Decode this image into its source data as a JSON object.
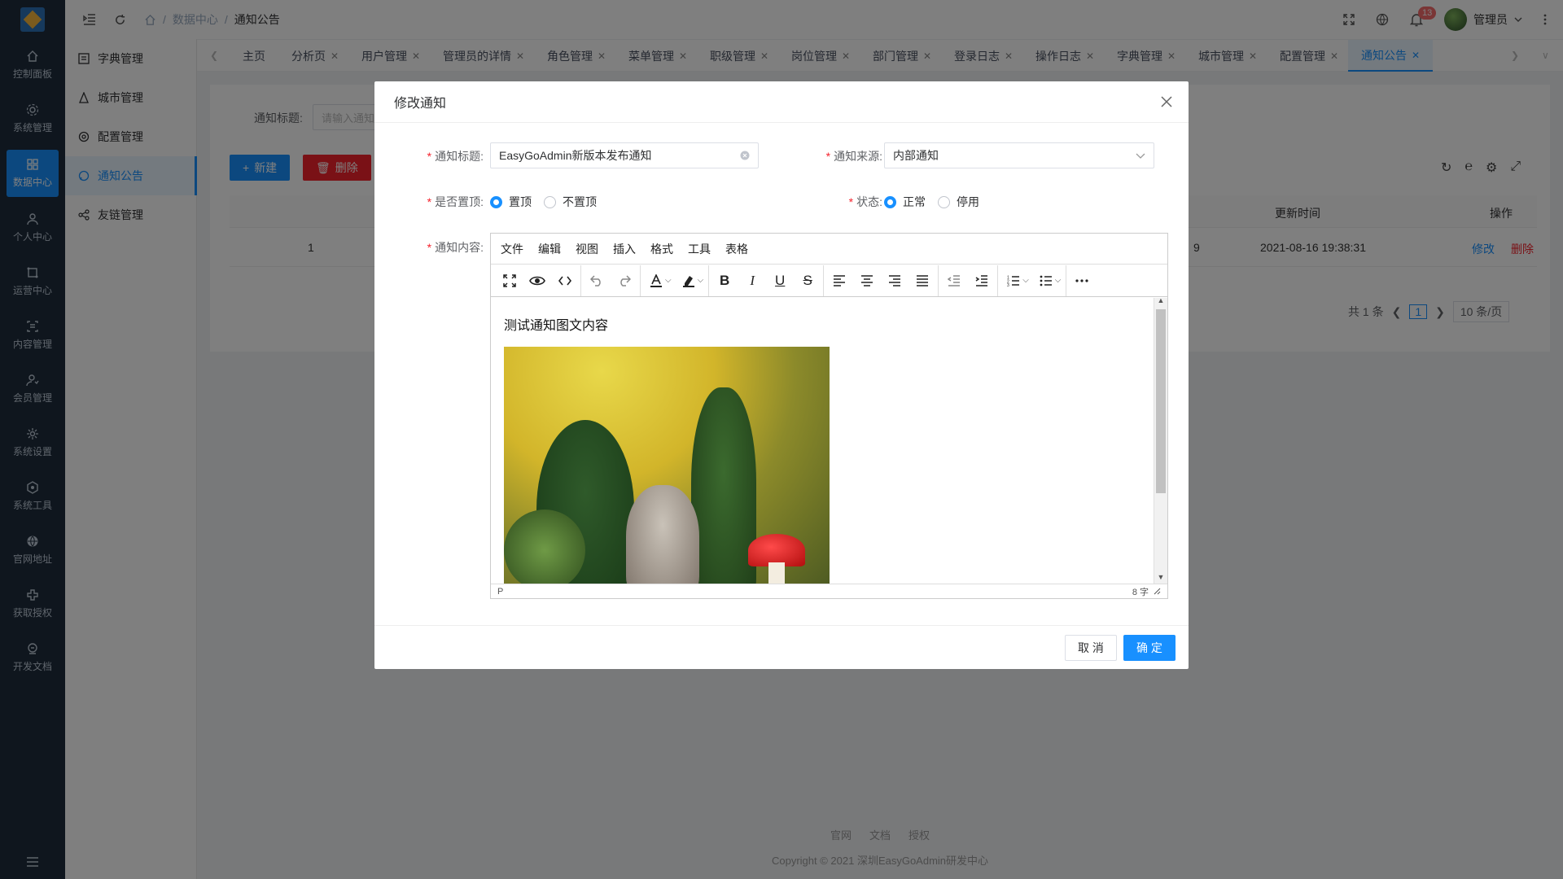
{
  "rail": {
    "items": [
      {
        "label": "控制面板",
        "icon": "home-icon"
      },
      {
        "label": "系统管理",
        "icon": "settings-icon"
      },
      {
        "label": "数据中心",
        "icon": "grid-icon"
      },
      {
        "label": "个人中心",
        "icon": "user-icon"
      },
      {
        "label": "运营中心",
        "icon": "operations-icon"
      },
      {
        "label": "内容管理",
        "icon": "content-icon"
      },
      {
        "label": "会员管理",
        "icon": "members-icon"
      },
      {
        "label": "系统设置",
        "icon": "gear-icon"
      },
      {
        "label": "系统工具",
        "icon": "tools-icon"
      },
      {
        "label": "官网地址",
        "icon": "globe-icon"
      },
      {
        "label": "获取授权",
        "icon": "authorize-icon"
      },
      {
        "label": "开发文档",
        "icon": "docs-icon"
      }
    ]
  },
  "submenu": {
    "items": [
      {
        "label": "字典管理"
      },
      {
        "label": "城市管理"
      },
      {
        "label": "配置管理"
      },
      {
        "label": "通知公告"
      },
      {
        "label": "友链管理"
      }
    ]
  },
  "topbar": {
    "breadcrumb": [
      "数据中心",
      "通知公告"
    ],
    "notification_count": "13",
    "user_name": "管理员"
  },
  "tabs": [
    {
      "label": "主页"
    },
    {
      "label": "分析页"
    },
    {
      "label": "用户管理"
    },
    {
      "label": "管理员的详情"
    },
    {
      "label": "角色管理"
    },
    {
      "label": "菜单管理"
    },
    {
      "label": "职级管理"
    },
    {
      "label": "岗位管理"
    },
    {
      "label": "部门管理"
    },
    {
      "label": "登录日志"
    },
    {
      "label": "操作日志"
    },
    {
      "label": "字典管理"
    },
    {
      "label": "城市管理"
    },
    {
      "label": "配置管理"
    },
    {
      "label": "通知公告"
    }
  ],
  "page": {
    "search_label": "通知标题:",
    "search_placeholder": "请输入通知",
    "new_button": "新建",
    "delete_button": "删除",
    "table": {
      "col_update_time": "更新时间",
      "col_actions": "操作",
      "row": {
        "id": "1",
        "partial": "9",
        "update_time": "2021-08-16 19:38:31",
        "edit": "修改",
        "delete": "删除"
      }
    },
    "pagination": {
      "total": "共 1 条",
      "current": "1",
      "page_size": "10 条/页"
    }
  },
  "footer": {
    "links": [
      "官网",
      "文档",
      "授权"
    ],
    "copyright": "Copyright © 2021 深圳EasyGoAdmin研发中心"
  },
  "modal": {
    "title": "修改通知",
    "title_label": "通知标题:",
    "title_value": "EasyGoAdmin新版本发布通知",
    "source_label": "通知来源:",
    "source_value": "内部通知",
    "pin_label": "是否置顶:",
    "pin_options": [
      "置顶",
      "不置顶"
    ],
    "status_label": "状态:",
    "status_options": [
      "正常",
      "停用"
    ],
    "content_label": "通知内容:",
    "editor": {
      "menus": [
        "文件",
        "编辑",
        "视图",
        "插入",
        "格式",
        "工具",
        "表格"
      ],
      "content_text": "测试通知图文内容",
      "status_path": "P",
      "word_count": "8 字"
    },
    "cancel_button": "取 消",
    "ok_button": "确 定"
  },
  "colors": {
    "primary": "#1890ff",
    "danger": "#f5222d",
    "rail_bg": "#1f2d3d"
  }
}
